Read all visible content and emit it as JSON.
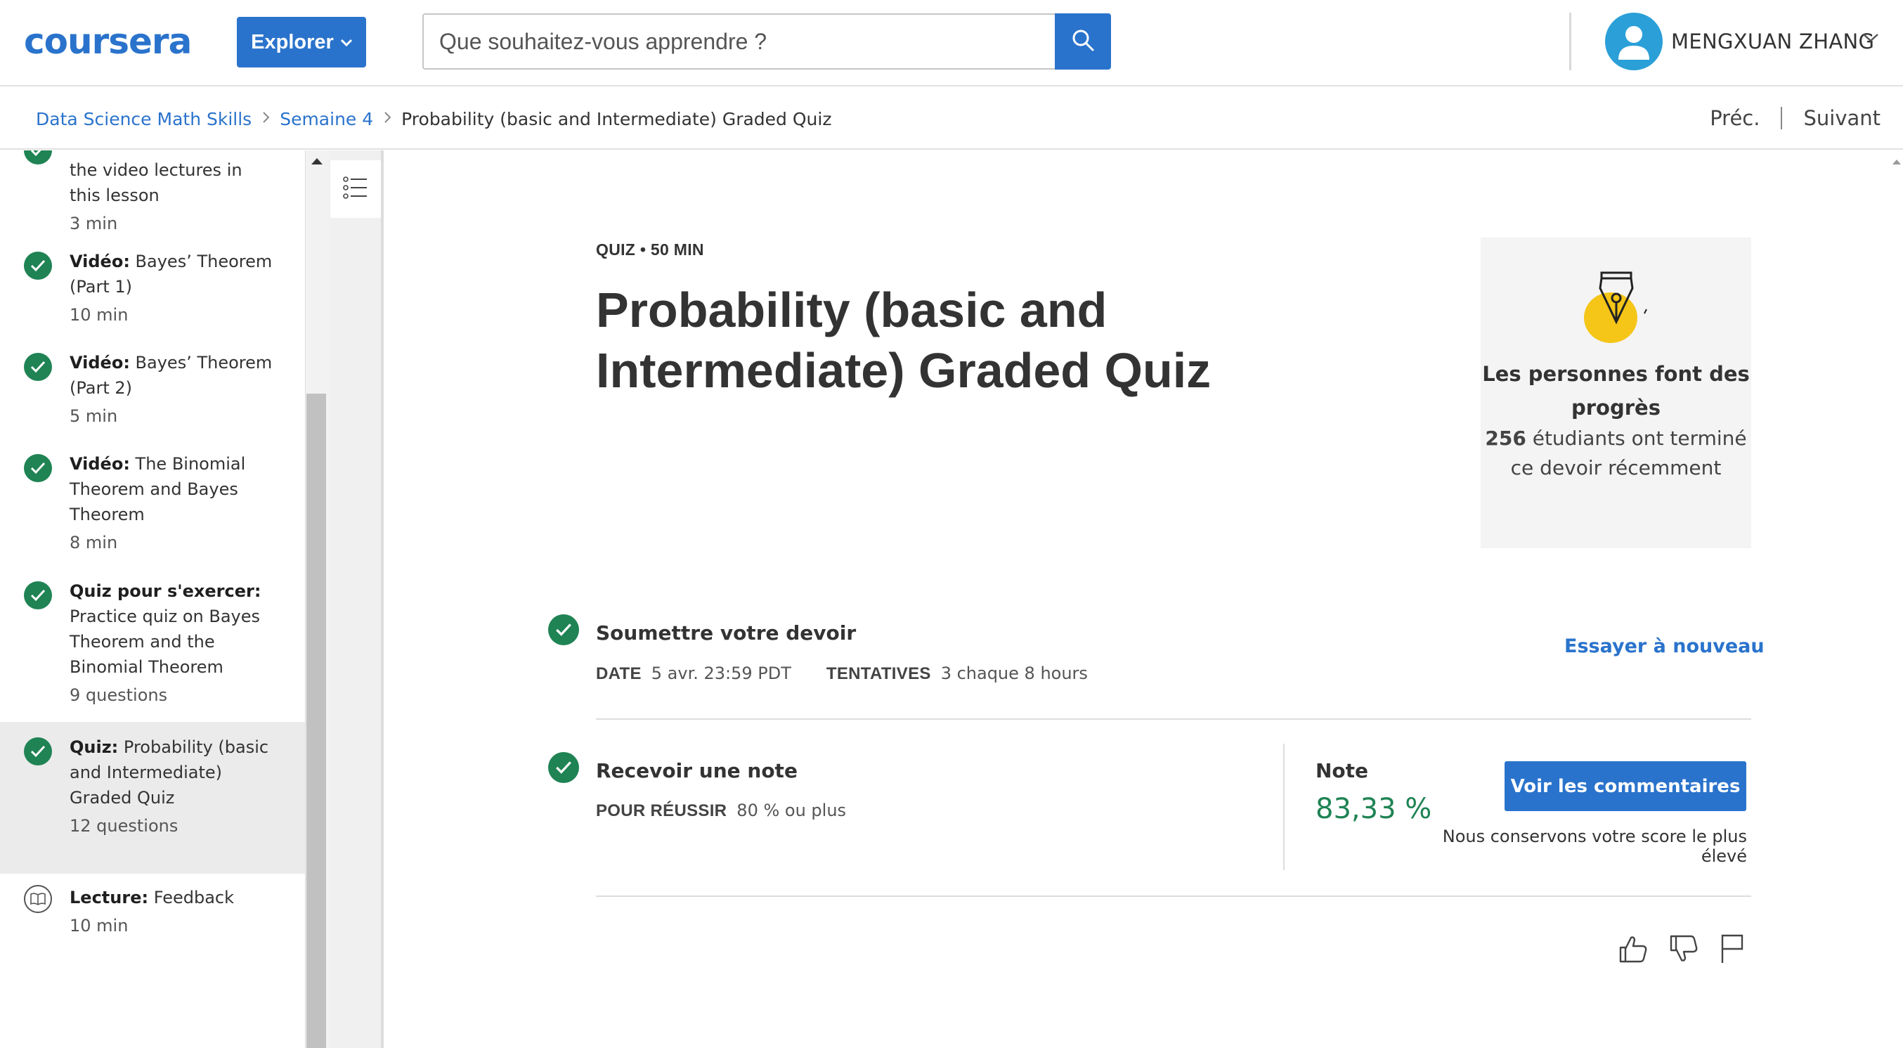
{
  "header": {
    "logo": "coursera",
    "explore_label": "Explorer",
    "search_placeholder": "Que souhaitez-vous apprendre ?",
    "user_name": "MENGXUAN ZHANG"
  },
  "breadcrumb": {
    "course": "Data Science Math Skills",
    "week": "Semaine 4",
    "current": "Probability (basic and Intermediate) Graded Quiz"
  },
  "nav": {
    "prev": "Préc.",
    "next": "Suivant"
  },
  "sidebar": {
    "items": [
      {
        "type": "",
        "title": "the video lectures in this lesson",
        "meta": "3  min",
        "status": "completed"
      },
      {
        "type": "Vidéo:",
        "title": " Bayes’ Theorem (Part 1)",
        "meta": "10  min",
        "status": "completed"
      },
      {
        "type": "Vidéo:",
        "title": " Bayes’ Theorem (Part 2)",
        "meta": "5  min",
        "status": "completed"
      },
      {
        "type": "Vidéo:",
        "title": " The Binomial Theorem and Bayes Theorem",
        "meta": "8  min",
        "status": "completed"
      },
      {
        "type": "Quiz pour s'exercer:",
        "title": " Practice quiz on Bayes Theorem and the Binomial Theorem",
        "meta": "9 questions",
        "status": "completed"
      },
      {
        "type": "Quiz:",
        "title": " Probability (basic and Intermediate) Graded Quiz",
        "meta": "12 questions",
        "status": "completed",
        "active": true
      },
      {
        "type": "Lecture:",
        "title": " Feedback",
        "meta": "10  min",
        "status": "reading"
      }
    ]
  },
  "quiz": {
    "meta": "QUIZ • 50  MIN",
    "title": "Probability (basic and Intermediate) Graded Quiz"
  },
  "progress_card": {
    "heading": "Les personnes font des progrès",
    "count": "256",
    "text": " étudiants ont terminé ce devoir récemment"
  },
  "submit": {
    "title": "Soumettre votre devoir",
    "date_label": "DATE",
    "date_value": "5 avr. 23:59 PDT",
    "attempts_label": "TENTATIVES",
    "attempts_value": "3 chaque 8  hours",
    "retry": "Essayer à nouveau"
  },
  "grade": {
    "title": "Recevoir une note",
    "pass_label": "POUR RÉUSSIR",
    "pass_value": "80 % ou plus",
    "note_label": "Note",
    "note_value": "83,33 %",
    "feedback_button": "Voir les commentaires",
    "keep_note": "Nous conservons votre score le plus élevé"
  },
  "colors": {
    "brand": "#2a73cc",
    "success": "#1f8354",
    "avatar": "#2a9fd8",
    "pen_badge": "#f5c518"
  },
  "icons": [
    "search-icon",
    "user-icon",
    "chevron-down-icon",
    "check-icon",
    "book-icon",
    "list-icon",
    "pen-icon",
    "thumbs-up-icon",
    "thumbs-down-icon",
    "flag-icon"
  ]
}
